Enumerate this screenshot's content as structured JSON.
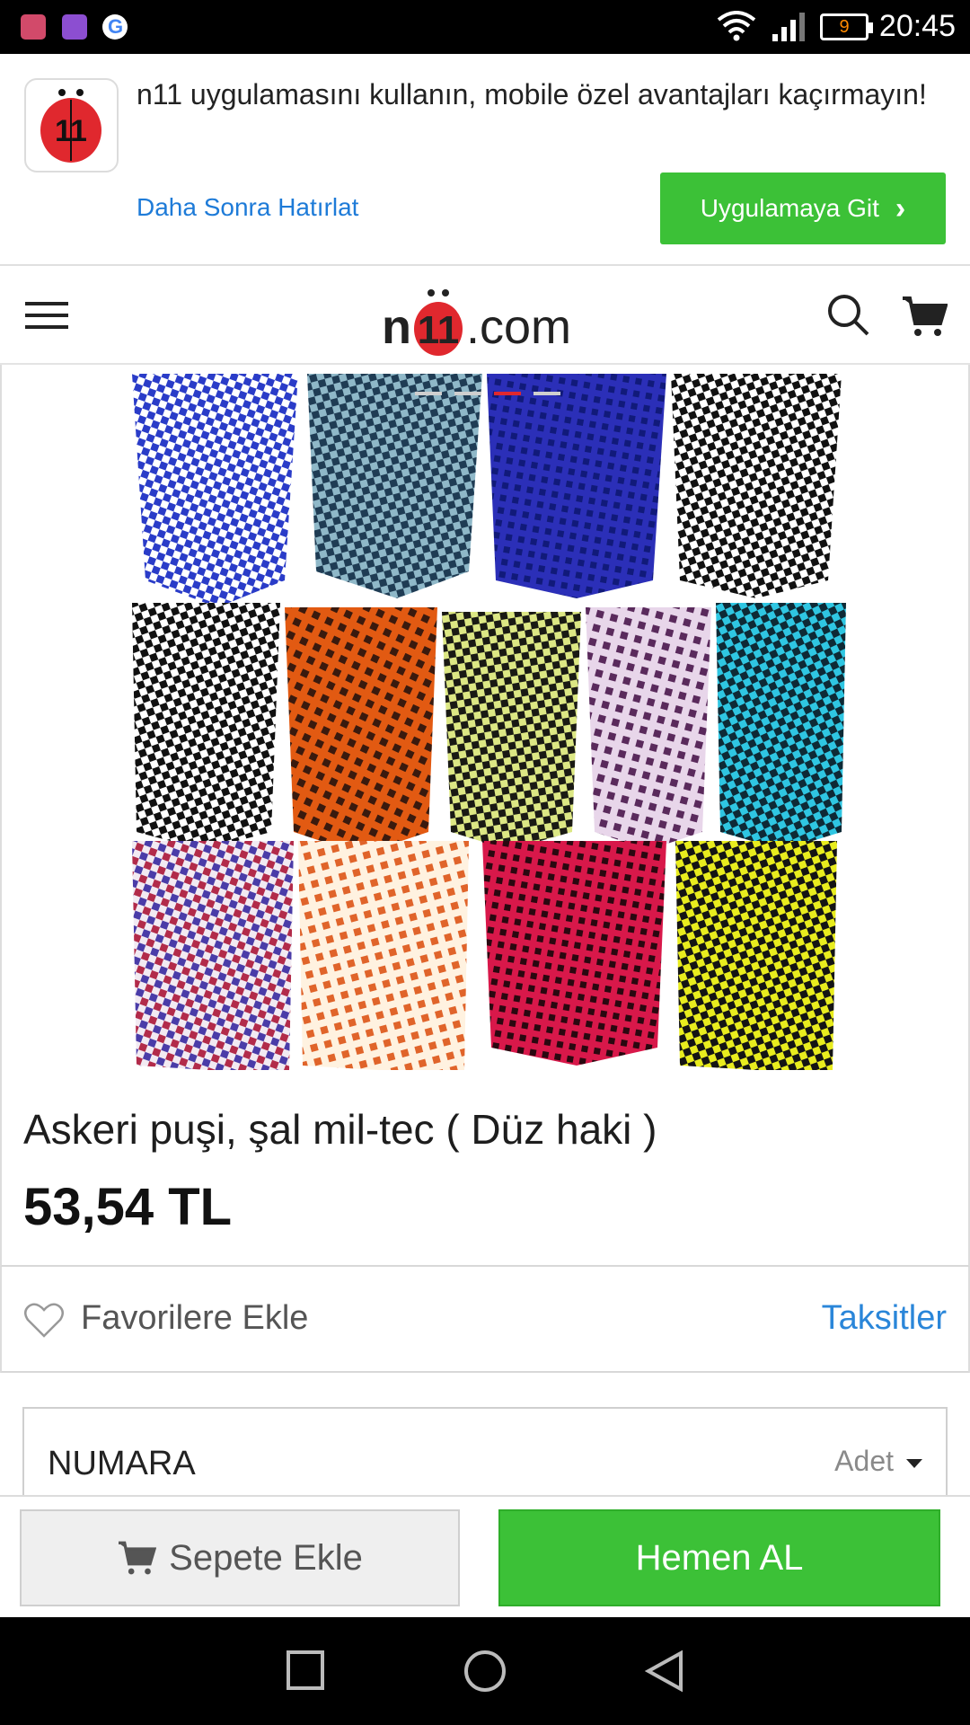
{
  "status_bar": {
    "time": "20:45",
    "battery": "9",
    "icons": [
      "notification-app-icon",
      "gallery-icon",
      "google-icon",
      "wifi-icon",
      "signal-icon",
      "battery-icon"
    ]
  },
  "app_banner": {
    "message": "n11 uygulamasını kullanın, mobile özel avantajları kaçırmayın!",
    "later_label": "Daha Sonra Hatırlat",
    "go_label": "Uygulamaya Git",
    "icon": "n11-app-icon"
  },
  "header": {
    "logo_n": "n",
    "logo_11": "11",
    "logo_com": ".com",
    "icons": [
      "menu-icon",
      "search-icon",
      "cart-icon"
    ]
  },
  "carousel": {
    "slide_count": 4,
    "active_index": 2
  },
  "product": {
    "title": "Askeri puşi, şal mil-tec ( Düz haki )",
    "price": "53,54 TL"
  },
  "actions": {
    "favorite_label": "Favorilere Ekle",
    "installments_label": "Taksitler"
  },
  "option": {
    "label": "NUMARA",
    "select_placeholder": "Adet"
  },
  "bottom_bar": {
    "add_to_cart_label": "Sepete Ekle",
    "buy_now_label": "Hemen AL"
  },
  "colors": {
    "brand_green": "#3cc137",
    "brand_red": "#e0282e",
    "link_blue": "#2a86d9"
  }
}
